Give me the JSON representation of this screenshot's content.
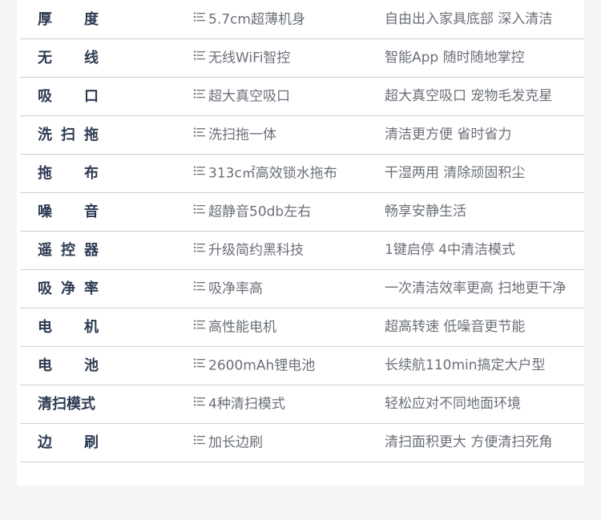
{
  "rows": [
    {
      "label": [
        "厚",
        "度"
      ],
      "feature": "5.7cm超薄机身",
      "desc": "自由出入家具底部 深入清洁"
    },
    {
      "label": [
        "无",
        "线"
      ],
      "feature": "无线WiFi智控",
      "desc": "智能App 随时随地掌控"
    },
    {
      "label": [
        "吸",
        "口"
      ],
      "feature": "超大真空吸口",
      "desc": "超大真空吸口 宠物毛发克星"
    },
    {
      "label": [
        "洗",
        "扫",
        "拖"
      ],
      "feature": "洗扫拖一体",
      "desc": "清洁更方便 省时省力"
    },
    {
      "label": [
        "拖",
        "布"
      ],
      "feature": "313c㎡高效锁水拖布",
      "desc": "干湿两用 清除顽固积尘"
    },
    {
      "label": [
        "噪",
        "音"
      ],
      "feature": "超静音50db左右",
      "desc": "畅享安静生活"
    },
    {
      "label": [
        "遥",
        "控",
        "器"
      ],
      "feature": "升级简约黑科技",
      "desc": "1键启停 4中清洁模式"
    },
    {
      "label": [
        "吸",
        "净",
        "率"
      ],
      "feature": "吸净率高",
      "desc": "一次清洁效率更高 扫地更干净"
    },
    {
      "label": [
        "电",
        "机"
      ],
      "feature": "高性能电机",
      "desc": "超高转速 低噪音更节能"
    },
    {
      "label": [
        "电",
        "池"
      ],
      "feature": "2600mAh锂电池",
      "desc": "长续航110min搞定大户型"
    },
    {
      "label": [
        "清扫模式"
      ],
      "feature": "4种清扫模式",
      "desc": "轻松应对不同地面环境"
    },
    {
      "label": [
        "边",
        "刷"
      ],
      "feature": "加长边刷",
      "desc": "清扫面积更大 方便清扫死角"
    }
  ],
  "colors": {
    "label": "#2d3a52",
    "text": "#6a6f78",
    "divider": "#cfcfcf",
    "background": "#f5f5f5",
    "card": "#ffffff"
  },
  "icon_name": "list-icon"
}
